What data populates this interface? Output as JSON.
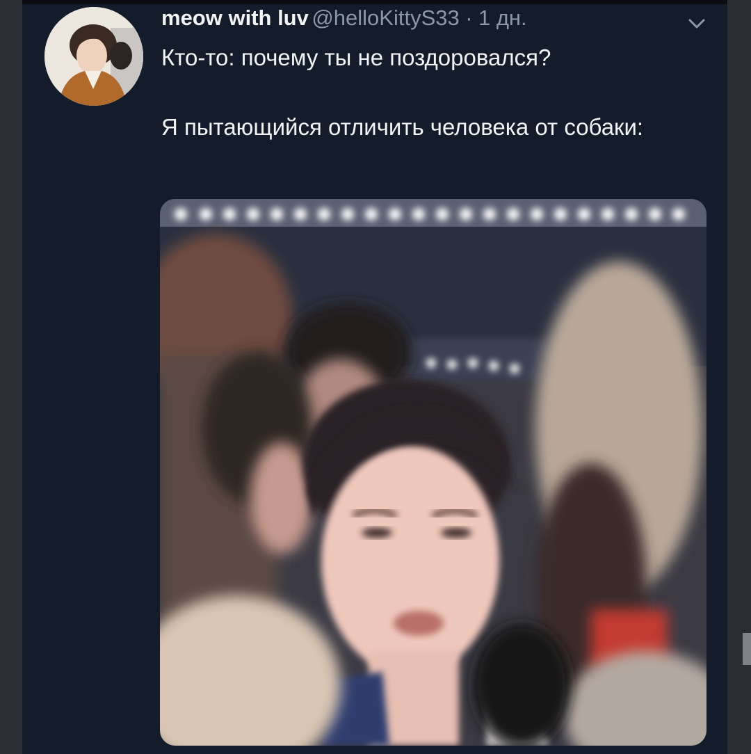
{
  "tweet": {
    "display_name": "meow with luv",
    "handle": "@helloKittyS33",
    "separator": "·",
    "time": "1 дн.",
    "text_line1": "Кто-то: почему ты не поздоровался?",
    "text_line2": "Я пытающийся отличить человека от собаки:"
  },
  "icons": {
    "menu": "chevron-down-icon"
  },
  "colors": {
    "background": "#141c2b",
    "text": "#f1f3f5",
    "muted": "#8b98a6"
  }
}
